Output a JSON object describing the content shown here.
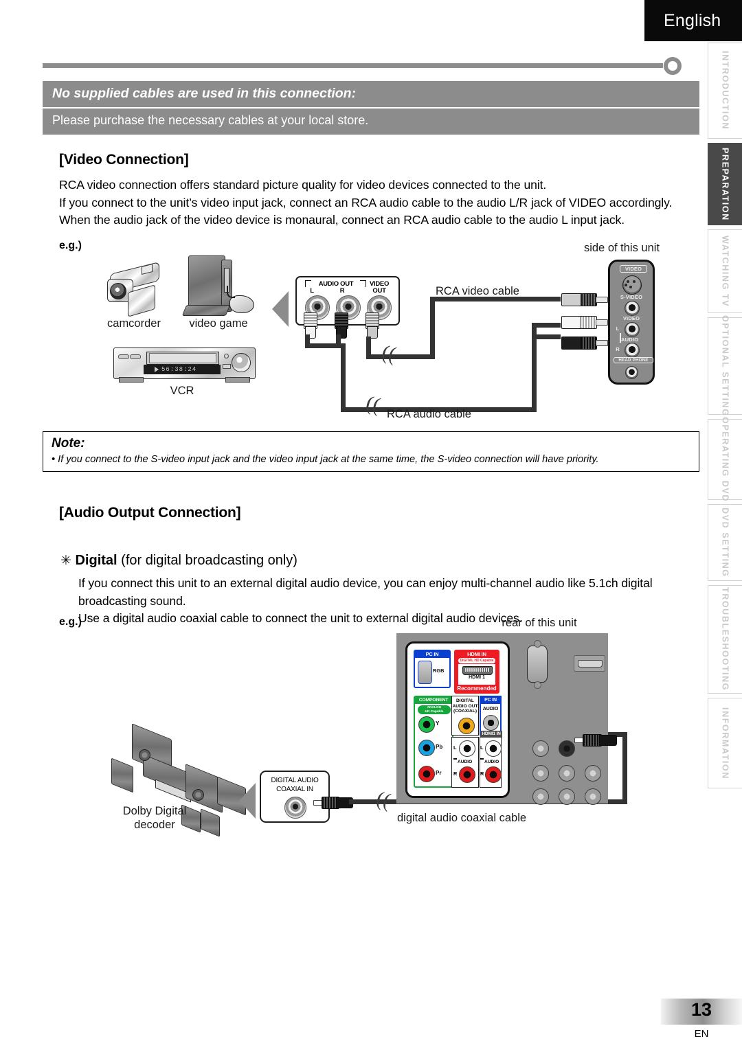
{
  "header": {
    "language_tab": "English"
  },
  "banner": {
    "title": "No supplied cables are used in this connection:",
    "subtitle": "Please purchase the necessary cables at your local store."
  },
  "side_rail": {
    "tabs": [
      {
        "label": "INTRODUCTION",
        "active": false
      },
      {
        "label": "PREPARATION",
        "active": true
      },
      {
        "label": "WATCHING TV",
        "active": false
      },
      {
        "label": "OPTIONAL SETTING",
        "active": false
      },
      {
        "label": "OPERATING DVD",
        "active": false
      },
      {
        "label": "DVD SETTING",
        "active": false
      },
      {
        "label": "TROUBLESHOOTING",
        "active": false
      },
      {
        "label": "INFORMATION",
        "active": false
      }
    ]
  },
  "video_connection": {
    "heading": "[Video Connection]",
    "paragraph_lines": [
      "RCA video connection offers standard picture quality for video devices connected to the unit.",
      "If you connect to the unit’s video input jack, connect an RCA audio cable to the audio L/R jack of VIDEO accordingly.",
      "When the audio jack of the video device is monaural, connect an RCA audio cable to the audio L input jack."
    ],
    "eg_label": "e.g.)",
    "devices": {
      "camcorder": "camcorder",
      "video_game": "video game",
      "vcr": "VCR",
      "vcr_display": "56:38:24"
    },
    "jack_block": {
      "audio_out": "AUDIO OUT",
      "left": "L",
      "right": "R",
      "video_out_line1": "VIDEO",
      "video_out_line2": "OUT"
    },
    "cables": {
      "video": "RCA video cable",
      "audio": "RCA audio cable"
    },
    "unit_side": {
      "caption": "side of this unit",
      "video_badge": "VIDEO",
      "s_video": "S-VIDEO",
      "video": "VIDEO",
      "audio": "AUDIO",
      "audio_l": "L",
      "audio_r": "R",
      "headphone": "HEAD PHONE"
    }
  },
  "note": {
    "title": "Note:",
    "items": [
      "If you connect to the S-video input jack and the video input jack at the same time, the S-video connection will have priority."
    ]
  },
  "audio_output_connection": {
    "heading": "[Audio Output Connection]",
    "bullet_glyph": "✳",
    "bullet_bold": "Digital",
    "bullet_rest": "(for digital broadcasting only)",
    "paragraph_lines": [
      "If you connect this unit to an external digital audio device, you can enjoy multi-channel audio like 5.1ch digital",
      "broadcasting sound.",
      "Use a digital audio coaxial cable to connect the unit to external digital audio devices."
    ],
    "eg_label": "e.g.)",
    "decoder_label_line1": "Dolby Digital",
    "decoder_label_line2": "decoder",
    "coax_in": {
      "line1": "DIGITAL AUDIO",
      "line2": "COAXIAL IN"
    },
    "cable_label": "digital audio coaxial cable",
    "unit_rear": {
      "caption": "rear of this unit",
      "pc_in_1": "PC IN",
      "rgb": "RGB",
      "hdmi_in": "HDMI IN",
      "hdmi_badge": "DIGITAL HD Capable",
      "hdmi_1": "HDMI 1",
      "recommended": "Recommended",
      "component": "COMPONENT",
      "component_badge_l1": "ANALOG",
      "component_badge_l2": "HD Capable",
      "comp_y": "Y",
      "comp_pb": "Pb",
      "comp_pr": "Pr",
      "digital_audio_out_l1": "DIGITAL",
      "digital_audio_out_l2": "AUDIO OUT",
      "digital_audio_out_l3": "(COAXIAL)",
      "pc_in_2": "PC IN",
      "pc_audio": "AUDIO",
      "hdmi1_in": "HDMI1 IN",
      "audio_label": "AUDIO",
      "audio_l": "L",
      "audio_r": "R"
    }
  },
  "footer": {
    "page_number": "13",
    "edition": "EN"
  },
  "colors": {
    "banner_gray": "#8c8c8c",
    "tab_active": "#494949",
    "blue": "#0b3fd0",
    "red": "#ee1b24",
    "green": "#14a83c",
    "orange": "#f0a818",
    "panel_gray": "#8f8f8f"
  }
}
